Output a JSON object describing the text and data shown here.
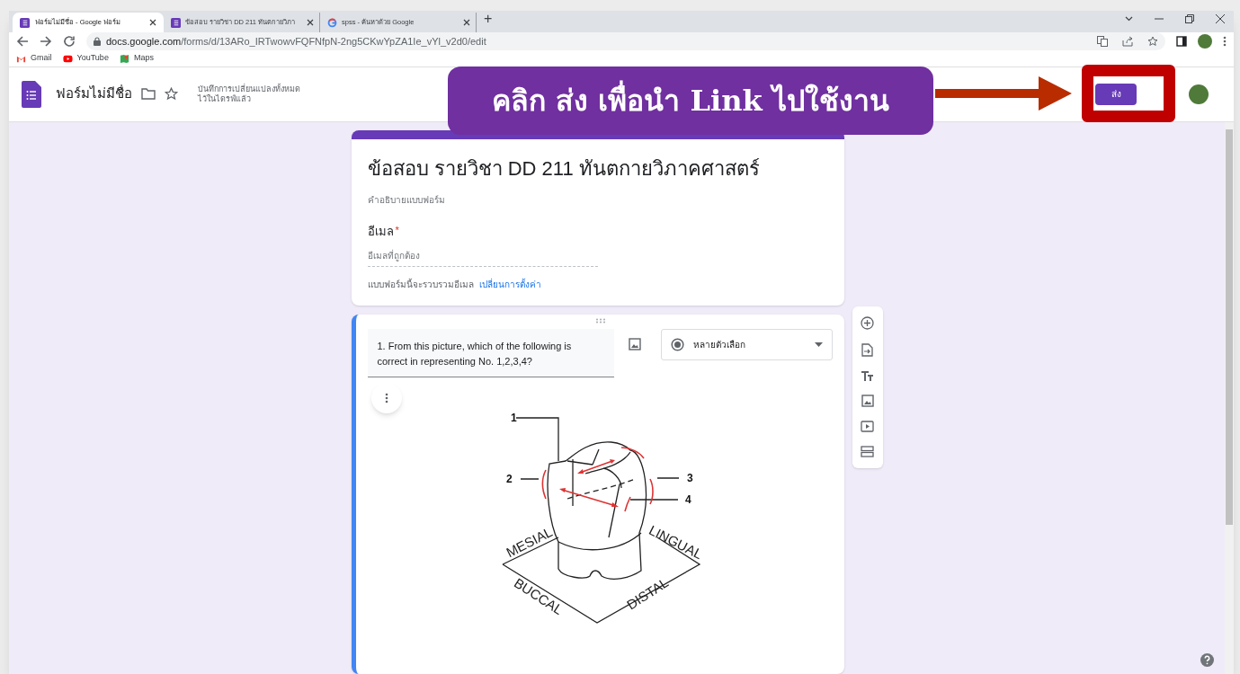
{
  "browser": {
    "tabs": [
      {
        "title": "ฟอร์มไม่มีชื่อ - Google ฟอร์ม",
        "kind": "forms",
        "selected": true
      },
      {
        "title": "ข้อสอบ รายวิชา DD 211 ทันตกายวิภา",
        "kind": "forms",
        "selected": false
      },
      {
        "title": "spss - ค้นหาด้วย Google",
        "kind": "google",
        "selected": false
      }
    ],
    "new_tab": "+",
    "url_host": "docs.google.com",
    "url_path": "/forms/d/13ARo_IRTwowvFQFNfpN-2ng5CKwYpZA1Ie_vYl_v2d0/edit",
    "bookmarks": [
      {
        "label": "Gmail",
        "kind": "gmail"
      },
      {
        "label": "YouTube",
        "kind": "youtube"
      },
      {
        "label": "Maps",
        "kind": "maps"
      }
    ]
  },
  "header": {
    "title": "ฟอร์มไม่มีชื่อ",
    "save_status": [
      "บันทึกการเปลี่ยนแปลงทั้งหมด",
      "ไว้ในไดรฟ์แล้ว"
    ],
    "send_button": "ส่ง"
  },
  "callout": {
    "text": "คลิก ส่ง เพื่อนำ Link ไปใช้งาน"
  },
  "form": {
    "title": "ข้อสอบ รายวิชา DD 211 ทันตกายวิภาคศาสตร์",
    "description": "คำอธิบายแบบฟอร์ม",
    "email_label": "อีเมล",
    "required_mark": "*",
    "email_placeholder": "อีเมลที่ถูกต้อง",
    "email_note": "แบบฟอร์มนี้จะรวบรวมอีเมล",
    "settings_link": "เปลี่ยนการตั้งค่า"
  },
  "question": {
    "text": "1. From this picture, which of the following is correct in representing No. 1,2,3,4?",
    "type": "หลายตัวเลือก",
    "figure_numbers": [
      "1",
      "2",
      "3",
      "4"
    ],
    "figure_sides": [
      "MESIAL",
      "LINGUAL",
      "BUCCAL",
      "DISTAL"
    ]
  }
}
